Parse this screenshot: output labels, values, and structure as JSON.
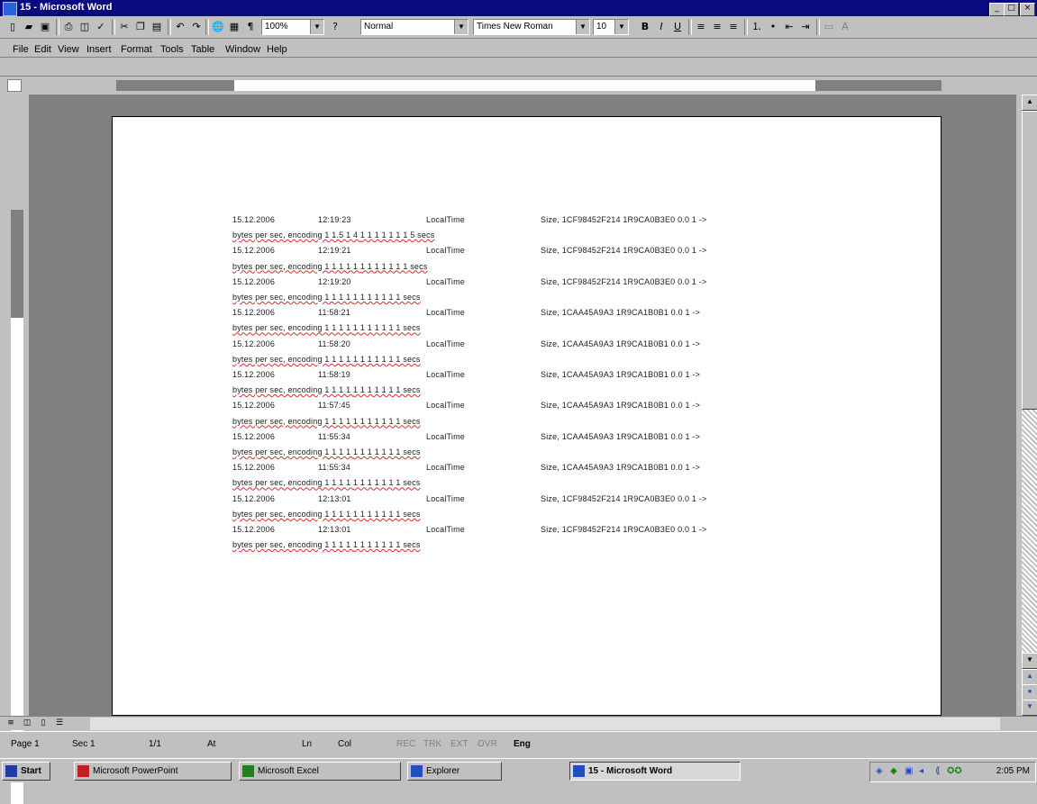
{
  "window": {
    "title": "15 - Microsoft Word"
  },
  "toolbar": {
    "zoom": "100%",
    "style": "Normal",
    "font": "Times New Roman",
    "size": "10"
  },
  "menu": [
    "File",
    "Edit",
    "View",
    "Insert",
    "Format",
    "Tools",
    "Table",
    "Window",
    "Help"
  ],
  "document": {
    "lines": [
      {
        "d": "15.12.2006",
        "t": "12:19:23",
        "k": "LocalTime",
        "z": "",
        "r": "Size, 1CF98452F214 1R9CA0B3E0 0.0 1 ->",
        "sub": false
      },
      {
        "d": "bytes per sec, encoding 1 1.5 1 4",
        "t": "",
        "k": "",
        "z": "",
        "r": "1 1 1 1 1 1 1 5 secs",
        "sub": true
      },
      {
        "d": "15.12.2006",
        "t": "12:19:21",
        "k": "LocalTime",
        "z": "",
        "r": "Size, 1CF98452F214 1R9CA0B3E0 0.0 1 ->",
        "sub": false
      },
      {
        "d": "bytes per sec, encoding 1 1 1 1 1",
        "t": "",
        "k": "",
        "z": "",
        "r": "1 1 1 1 1 1 1 secs",
        "sub": true
      },
      {
        "d": "15.12.2006",
        "t": "12:19:20",
        "k": "LocalTime",
        "z": "",
        "r": "Size, 1CF98452F214 1R9CA0B3E0 0.0 1 ->",
        "sub": false
      },
      {
        "d": "bytes per sec, encoding 1 1 1 1",
        "t": "",
        "k": "",
        "z": "",
        "r": "1 1 1 1 1 1 1 secs",
        "sub": true
      },
      {
        "d": "15.12.2006",
        "t": "11:58:21",
        "k": "LocalTime",
        "z": "",
        "r": "Size, 1CAA45A9A3 1R9CA1B0B1 0.0 1 ->",
        "sub": false
      },
      {
        "d": "bytes per sec, encoding 1 1 1 1",
        "t": "",
        "k": "",
        "z": "",
        "r": "1 1 1 1 1 1 1 secs",
        "sub": true
      },
      {
        "d": "15.12.2006",
        "t": "11:58:20",
        "k": "LocalTime",
        "z": "",
        "r": "Size, 1CAA45A9A3 1R9CA1B0B1 0.0 1 ->",
        "sub": false
      },
      {
        "d": "bytes per sec, encoding 1 1 1 1",
        "t": "",
        "k": "",
        "z": "",
        "r": "1 1 1 1 1 1 1 secs",
        "sub": true
      },
      {
        "d": "15.12.2006",
        "t": "11:58:19",
        "k": "LocalTime",
        "z": "",
        "r": "Size, 1CAA45A9A3 1R9CA1B0B1 0.0 1 ->",
        "sub": false
      },
      {
        "d": "bytes per sec, encoding 1 1 1 1",
        "t": "",
        "k": "",
        "z": "",
        "r": "1 1 1 1 1 1 1 secs",
        "sub": true
      },
      {
        "d": "15.12.2006",
        "t": "11:57:45",
        "k": "LocalTime",
        "z": "",
        "r": "Size, 1CAA45A9A3 1R9CA1B0B1 0.0 1 ->",
        "sub": false
      },
      {
        "d": "bytes per sec, encoding 1 1 1 1",
        "t": "",
        "k": "",
        "z": "",
        "r": "1 1 1 1 1 1 1 secs",
        "sub": true
      },
      {
        "d": "15.12.2006",
        "t": "11:55:34",
        "k": "LocalTime",
        "z": "",
        "r": "Size, 1CAA45A9A3 1R9CA1B0B1 0.0 1 ->",
        "sub": false
      },
      {
        "d": "bytes per sec, encoding 1 1 1 1",
        "t": "",
        "k": "",
        "z": "",
        "r": "1 1 1 1 1 1 1 secs",
        "sub": true
      },
      {
        "d": "15.12.2006",
        "t": "11:55:34",
        "k": "LocalTime",
        "z": "",
        "r": "Size, 1CAA45A9A3 1R9CA1B0B1 0.0 1 ->",
        "sub": false
      },
      {
        "d": "bytes per sec, encoding 1 1 1 1",
        "t": "",
        "k": "",
        "z": "",
        "r": "1 1 1 1 1 1 1 secs",
        "sub": true
      },
      {
        "d": "15.12.2006",
        "t": "12:13:01",
        "k": "LocalTime",
        "z": "",
        "r": "Size, 1CF98452F214 1R9CA0B3E0 0.0 1 ->",
        "sub": false
      },
      {
        "d": "bytes per sec, encoding 1 1 1 1",
        "t": "",
        "k": "",
        "z": "",
        "r": "1 1 1 1 1 1 1 secs",
        "sub": true
      },
      {
        "d": "15.12.2006",
        "t": "12:13:01",
        "k": "LocalTime",
        "z": "",
        "r": "Size, 1CF98452F214 1R9CA0B3E0 0.0 1 ->",
        "sub": false
      },
      {
        "d": "bytes per sec, encoding 1 1 1 1",
        "t": "",
        "k": "",
        "z": "",
        "r": "1 1 1 1 1 1 1 secs",
        "sub": true
      }
    ]
  },
  "status": {
    "page": "Page 1",
    "sec": "Sec 1",
    "pos": "1/1",
    "at": "At",
    "ln": "Ln",
    "col": "Col",
    "flags": [
      "REC",
      "TRK",
      "EXT",
      "OVR"
    ],
    "lang": "Eng"
  },
  "taskbar": {
    "start": "Start",
    "tasks": [
      {
        "label": "Microsoft PowerPoint",
        "color": "#c02020",
        "active": false
      },
      {
        "label": "Microsoft Excel",
        "color": "#208020",
        "active": false
      },
      {
        "label": "Explorer",
        "color": "#2050c0",
        "active": false
      },
      {
        "label": "15 - Microsoft Word",
        "color": "#2050c0",
        "active": true
      }
    ],
    "clock": "2:05 PM"
  }
}
